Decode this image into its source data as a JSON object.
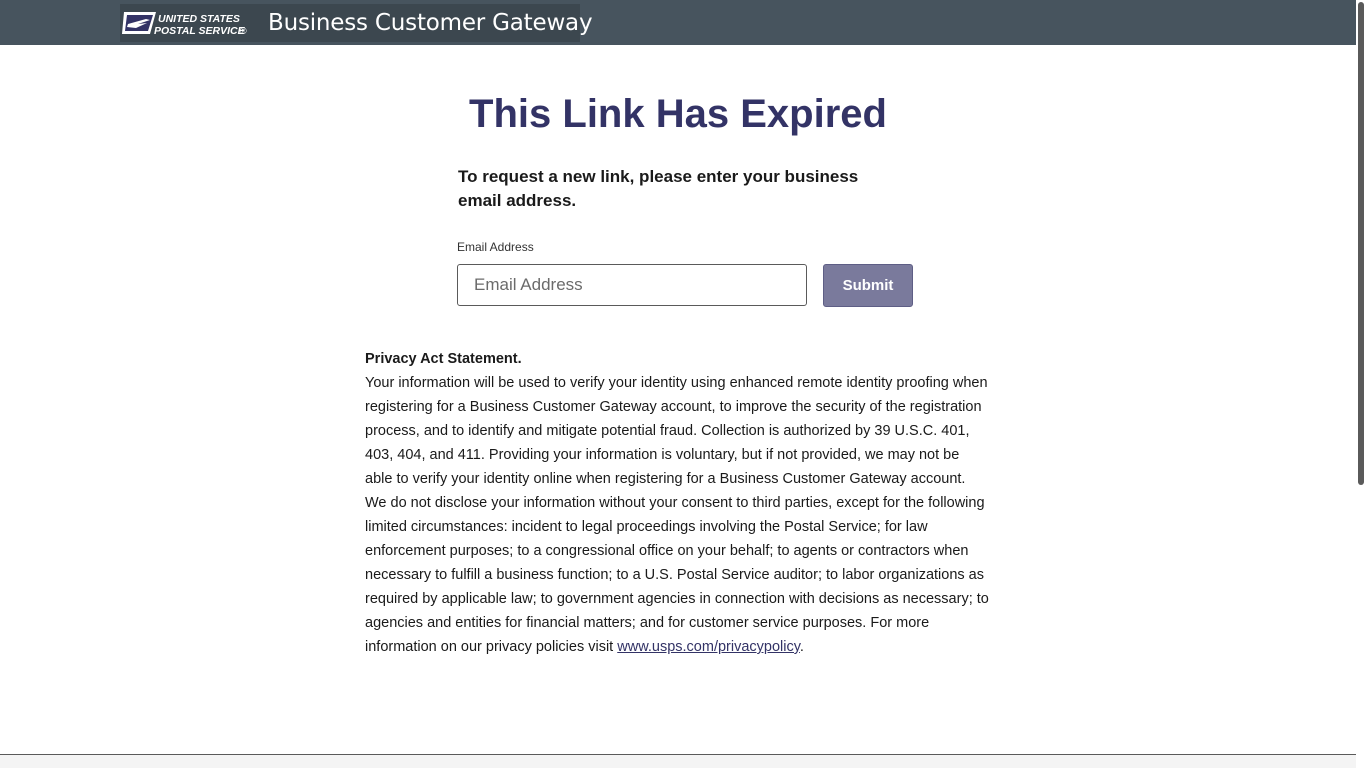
{
  "header": {
    "logo_line1": "UNITED STATES",
    "logo_line2": "POSTAL SERVICE",
    "logo_mark": "®",
    "app_title": "Business Customer Gateway"
  },
  "main": {
    "title": "This Link Has Expired",
    "instruction": "To request a new link, please enter your business email address.",
    "email_label": "Email Address",
    "email_placeholder": "Email Address",
    "email_value": "",
    "submit_label": "Submit"
  },
  "privacy": {
    "heading": "Privacy Act Statement.",
    "body": "Your information will be used to verify your identity using enhanced remote identity proofing when registering for a Business Customer Gateway account, to improve the security of the registration process, and to identify and mitigate potential fraud. Collection is authorized by 39 U.S.C. 401, 403, 404, and 411. Providing your information is voluntary, but if not provided, we may not be able to verify your identity online when registering for a Business Customer Gateway account. We do not disclose your information without your consent to third parties, except for the following limited circumstances: incident to legal proceedings involving the Postal Service; for law enforcement purposes; to a congressional office on your behalf; to agents or contractors when necessary to fulfill a business function; to a U.S. Postal Service auditor; to labor organizations as required by applicable law; to government agencies in connection with decisions as necessary; to agencies and entities for financial matters; and for customer service purposes. For more information on our privacy policies visit ",
    "link_text": "www.usps.com/privacypolicy",
    "trailing": "."
  },
  "colors": {
    "header_bg": "#47545e",
    "title": "#333366",
    "submit_bg": "#7a7a9c"
  },
  "icons": {
    "logo": "usps-eagle-logo"
  }
}
